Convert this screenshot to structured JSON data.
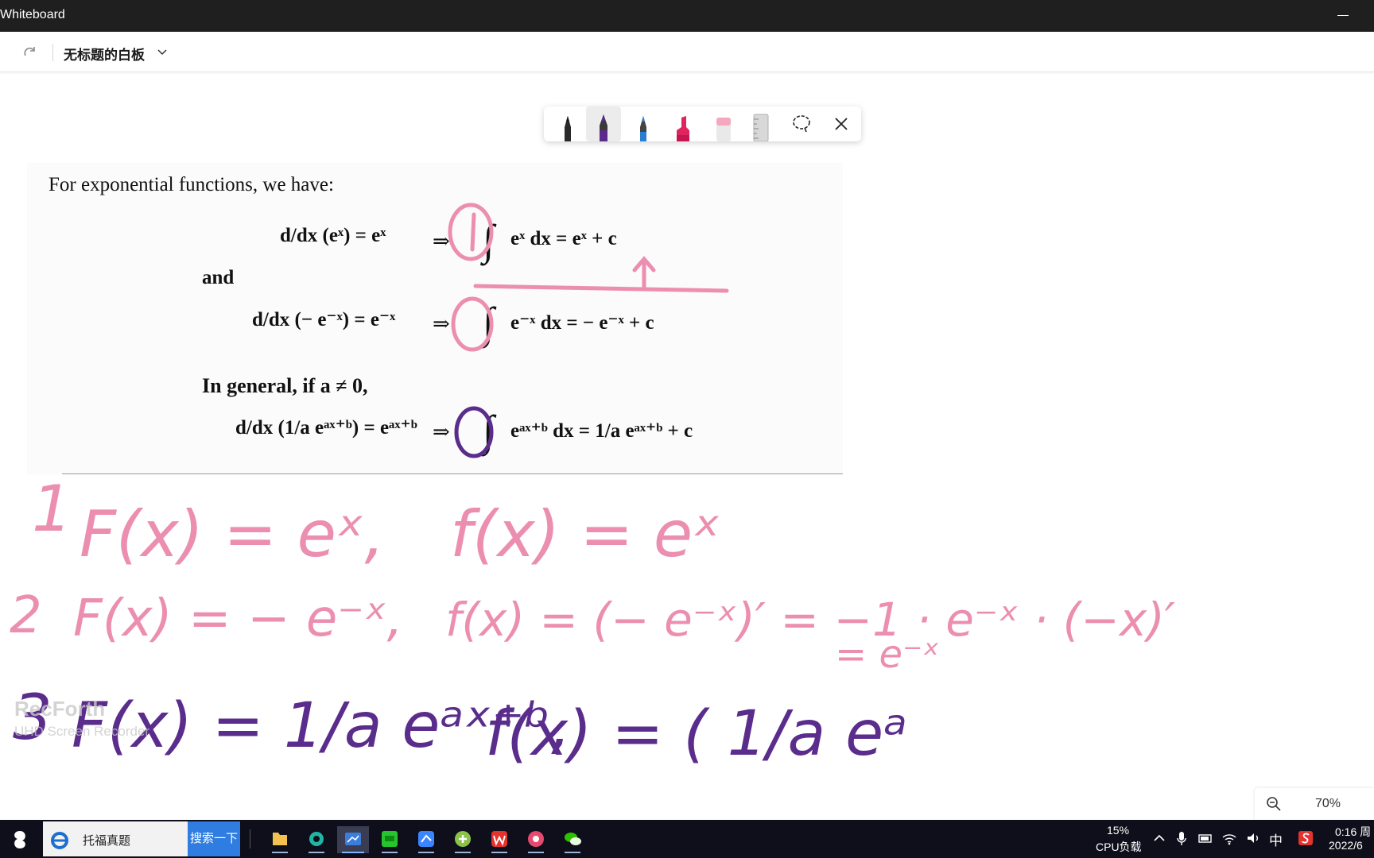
{
  "window": {
    "title": "Whiteboard"
  },
  "toolbar": {
    "board_title": "无标题的白板"
  },
  "ink_palette": {
    "tools": [
      {
        "name": "black-pen",
        "color": "#222222"
      },
      {
        "name": "purple-pen",
        "color": "#5c2a8a",
        "selected": true
      },
      {
        "name": "blue-pen",
        "color": "#2b7fd0"
      },
      {
        "name": "red-highlighter",
        "color": "#e0245e"
      },
      {
        "name": "pink-eraser",
        "color": "#f4a8c0"
      },
      {
        "name": "ruler",
        "color": "#b5b5b5"
      }
    ]
  },
  "document": {
    "intro": "For exponential functions, we have:",
    "and": "and",
    "general": "In general, if a ≠ 0,",
    "eq1_left": "d/dx (eˣ) = eˣ",
    "eq1_right": "eˣ dx = eˣ + c",
    "eq2_left": "d/dx (− e⁻ˣ) = e⁻ˣ",
    "eq2_right": "e⁻ˣ dx = − e⁻ˣ + c",
    "eq3_left": "d/dx (1/a eᵃˣ⁺ᵇ) = eᵃˣ⁺ᵇ",
    "eq3_right": "eᵃˣ⁺ᵇ dx = 1/a eᵃˣ⁺ᵇ + c",
    "arrow": "⇒",
    "integral": "∫"
  },
  "ink": {
    "pink": "#ec8eb0",
    "purple": "#5a2c8c",
    "circle_labels": [
      "1",
      "2",
      "3"
    ],
    "line1": [
      "F(x) = eˣ,",
      "f(x) = eˣ"
    ],
    "line2": [
      "F(x) = − e⁻ˣ,",
      "f(x) = (− e⁻ˣ)′ = −1 · e⁻ˣ · (−x)′",
      "= e⁻ˣ"
    ],
    "line3": [
      "F(x) = 1/a eᵃˣ⁺ᵇ,",
      "f(x) = ( 1/a eᵃ"
    ]
  },
  "watermark": {
    "brand": "RecForth",
    "subtitle": "UHD Screen Recorder"
  },
  "zoom": {
    "level": "70%"
  },
  "taskbar": {
    "search_text": "托福真题",
    "search_button": "搜索一下",
    "cpu_percent": "15%",
    "cpu_label": "CPU负载",
    "ime": "中",
    "clock_time": "0:16 周",
    "clock_date": "2022/6"
  }
}
